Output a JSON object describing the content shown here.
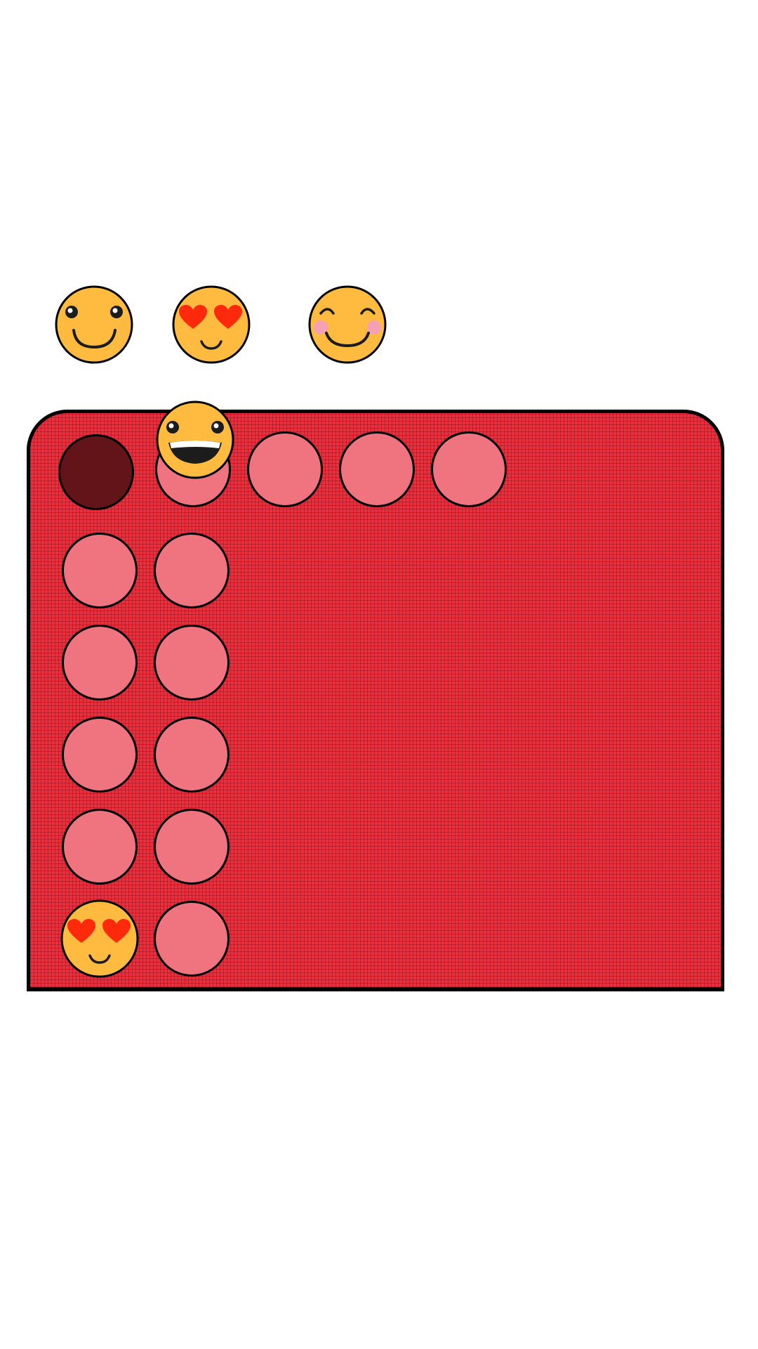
{
  "game": {
    "colors": {
      "background": "#ffffff",
      "board": "#ea2f3d",
      "slot_empty": "#ef7480",
      "slot_selected": "#631418",
      "emoji_face": "#ffbb3f",
      "heart": "#ff2a0c",
      "blush": "#f5a0b4",
      "outline": "#000000"
    },
    "queue": [
      {
        "emoji": "smile-icon"
      },
      {
        "emoji": "heart-eyes-icon"
      },
      {
        "emoji": "blushing-smile-icon"
      }
    ],
    "held_piece": {
      "emoji": "grinning-icon",
      "column": 2
    },
    "board": {
      "slots": [
        {
          "row": 1,
          "col": 1,
          "state": "selected"
        },
        {
          "row": 1,
          "col": 2,
          "state": "empty"
        },
        {
          "row": 1,
          "col": 3,
          "state": "empty"
        },
        {
          "row": 1,
          "col": 4,
          "state": "empty"
        },
        {
          "row": 1,
          "col": 5,
          "state": "empty"
        },
        {
          "row": 2,
          "col": 1,
          "state": "empty"
        },
        {
          "row": 2,
          "col": 2,
          "state": "empty"
        },
        {
          "row": 3,
          "col": 1,
          "state": "empty"
        },
        {
          "row": 3,
          "col": 2,
          "state": "empty"
        },
        {
          "row": 4,
          "col": 1,
          "state": "empty"
        },
        {
          "row": 4,
          "col": 2,
          "state": "empty"
        },
        {
          "row": 5,
          "col": 1,
          "state": "empty"
        },
        {
          "row": 5,
          "col": 2,
          "state": "empty"
        },
        {
          "row": 6,
          "col": 1,
          "state": "filled",
          "emoji": "heart-eyes-icon"
        },
        {
          "row": 6,
          "col": 2,
          "state": "empty"
        }
      ]
    }
  }
}
